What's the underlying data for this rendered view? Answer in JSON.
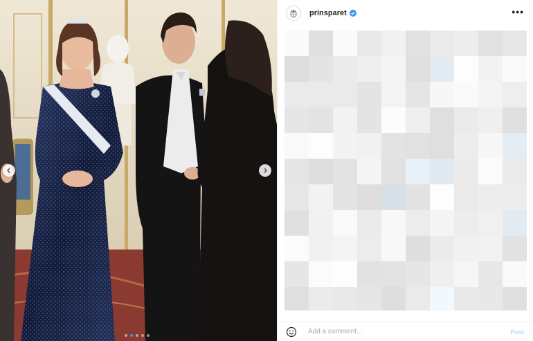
{
  "account": {
    "username": "prinsparet",
    "verified": true,
    "avatar_icon": "crest-icon"
  },
  "header": {
    "more_label": "•••"
  },
  "carousel": {
    "slide_count": 5,
    "active_slide": 1,
    "prev_icon": "chevron-left-icon",
    "next_icon": "chevron-right-icon"
  },
  "comment": {
    "placeholder": "Add a comment...",
    "post_label": "Post"
  },
  "colors": {
    "verified": "#3897f0",
    "dress": "#1c2748",
    "suit": "#141414",
    "carpet": "#8a3a30",
    "wall": "#e9dfc8"
  }
}
